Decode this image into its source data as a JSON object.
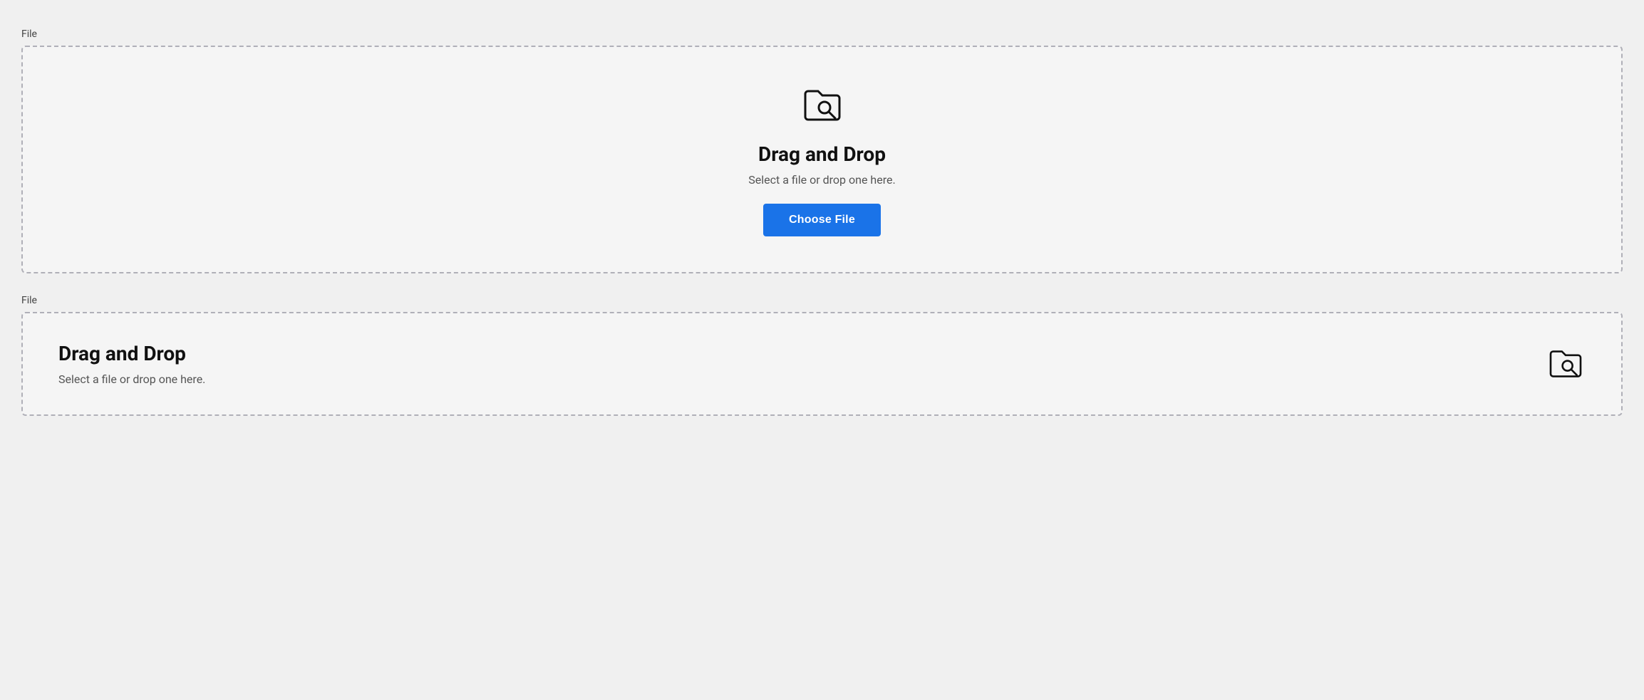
{
  "section1": {
    "label": "File",
    "dropzone": {
      "title": "Drag and Drop",
      "subtitle": "Select a file or drop one here.",
      "button_label": "Choose File"
    }
  },
  "section2": {
    "label": "File",
    "dropzone": {
      "title": "Drag and Drop",
      "subtitle": "Select a file or drop one here."
    }
  },
  "colors": {
    "button_bg": "#1a73e8"
  }
}
